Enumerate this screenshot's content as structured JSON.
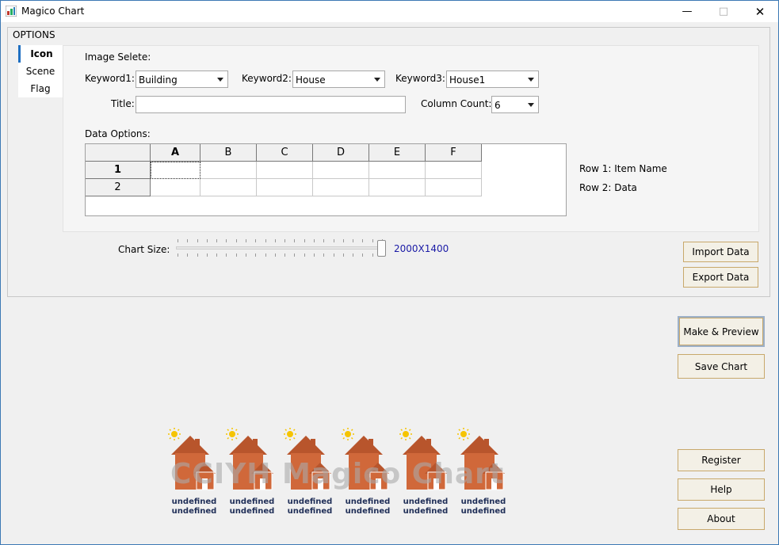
{
  "window": {
    "title": "Magico Chart"
  },
  "options": {
    "group_label": "OPTIONS",
    "tabs": [
      {
        "label": "Icon",
        "active": true
      },
      {
        "label": "Scene",
        "active": false
      },
      {
        "label": "Flag",
        "active": false
      }
    ],
    "image_select_label": "Image Selete:",
    "keyword1": {
      "label": "Keyword1:",
      "value": "Building"
    },
    "keyword2": {
      "label": "Keyword2:",
      "value": "House"
    },
    "keyword3": {
      "label": "Keyword3:",
      "value": "House1"
    },
    "title_field": {
      "label": "Title:",
      "value": ""
    },
    "column_count": {
      "label": "Column Count:",
      "value": "6"
    },
    "data_options_label": "Data Options:",
    "grid": {
      "columns": [
        "A",
        "B",
        "C",
        "D",
        "E",
        "F"
      ],
      "rows": [
        "1",
        "2"
      ]
    },
    "row_hints": {
      "row1": "Row 1: Item Name",
      "row2": "Row 2: Data"
    },
    "chart_size": {
      "label": "Chart Size:",
      "value": "2000X1400",
      "slider_fraction": 1.0
    }
  },
  "buttons": {
    "import": "Import Data",
    "export": "Export Data",
    "make_preview": "Make & Preview",
    "save_chart": "Save Chart",
    "register": "Register",
    "help": "Help",
    "about": "About"
  },
  "preview": {
    "watermark": "CCIYH Magico Chart",
    "captions": [
      {
        "line1": "undefined",
        "line2": "undefined"
      },
      {
        "line1": "undefined",
        "line2": "undefined"
      },
      {
        "line1": "undefined",
        "line2": "undefined"
      },
      {
        "line1": "undefined",
        "line2": "undefined"
      },
      {
        "line1": "undefined",
        "line2": "undefined"
      },
      {
        "line1": "undefined",
        "line2": "undefined"
      }
    ]
  },
  "colors": {
    "house": "#d0683a",
    "roof": "#b8552c",
    "sun": "#f5c400",
    "caption": "#1f2e57",
    "accent": "#1e6fc1",
    "value": "#1a1aa6"
  }
}
